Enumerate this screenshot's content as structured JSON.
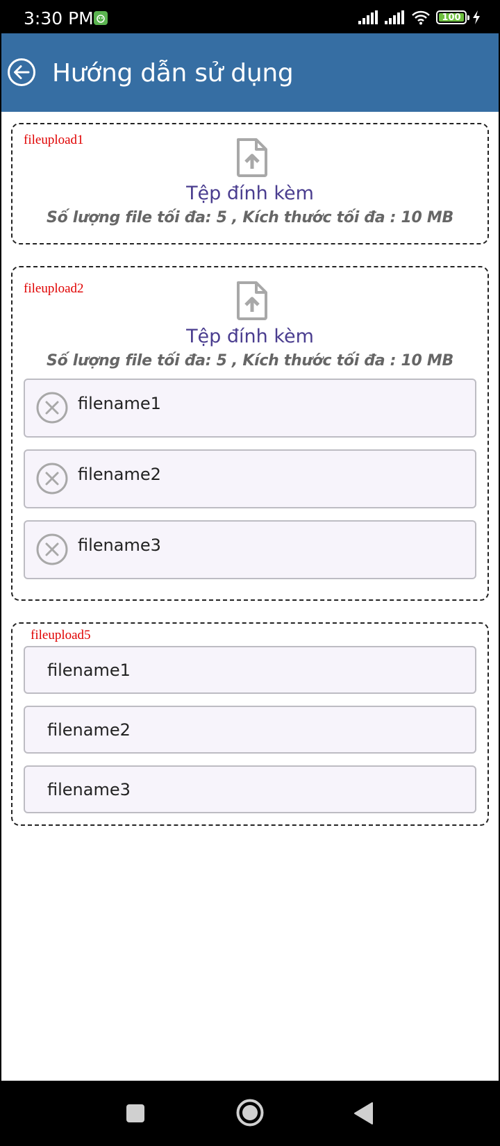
{
  "status_bar": {
    "time": "3:30 PM",
    "battery": "100",
    "icons": [
      "android-app-icon",
      "signal-icon",
      "signal-icon",
      "wifi-icon",
      "battery-icon",
      "charging-icon"
    ]
  },
  "app_bar": {
    "title": "Hướng dẫn sử dụng",
    "back_icon": "back-arrow-icon"
  },
  "uploads": {
    "upload1": {
      "label": "fileupload1",
      "title": "Tệp đính kèm",
      "limits": "Số lượng file tối đa:  5 ,  Kích thước tối đa  : 10 MB"
    },
    "upload2": {
      "label": "fileupload2",
      "title": "Tệp đính kèm",
      "limits": "Số lượng file tối đa:  5 ,  Kích thước tối đa  : 10 MB",
      "files": [
        "filename1",
        "filename2",
        "filename3"
      ]
    },
    "upload5": {
      "label": "fileupload5",
      "files": [
        "filename1",
        "filename2",
        "filename3"
      ]
    }
  },
  "colors": {
    "app_bar": "#366ea3",
    "label_red": "#e00000",
    "title_purple": "#4a3d8f",
    "file_bg": "#f7f4fb"
  },
  "nav_bar": {
    "buttons": [
      "recents-square-icon",
      "home-circle-icon",
      "back-triangle-icon"
    ]
  }
}
